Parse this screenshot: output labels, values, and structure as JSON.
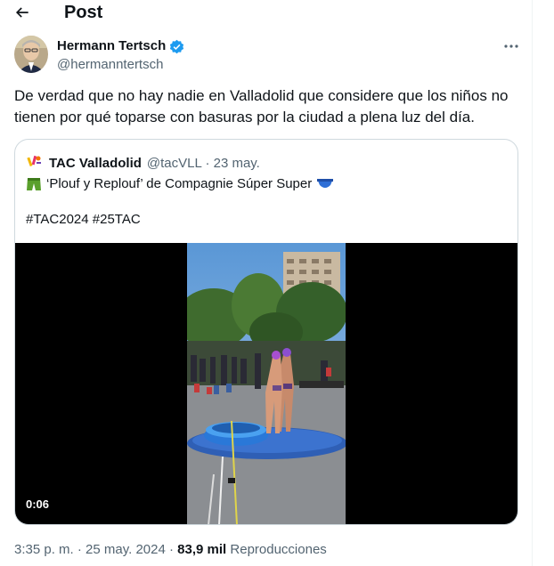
{
  "header": {
    "title": "Post",
    "back_icon": "arrow-left-icon"
  },
  "author": {
    "name": "Hermann Tertsch",
    "handle": "@hermanntertsch",
    "verified_color": "#1d9bf0"
  },
  "post": {
    "text": "De verdad que no hay nadie en Valladolid que considere que los niños no tienen por qué toparse con basuras por la ciudad a plena luz del día."
  },
  "quote": {
    "name": "TAC Valladolid",
    "meta": "@tacVLL · 23 may.",
    "line1": "‘Plouf y Replouf’ de Compagnie Súper Super",
    "line2": "#TAC2024 #25TAC",
    "video_time": "0:06"
  },
  "footer": {
    "time": "3:35 p. m.",
    "separator": "·",
    "date": "25 may. 2024",
    "views_count": "83,9 mil",
    "views_label": "Reproducciones"
  }
}
